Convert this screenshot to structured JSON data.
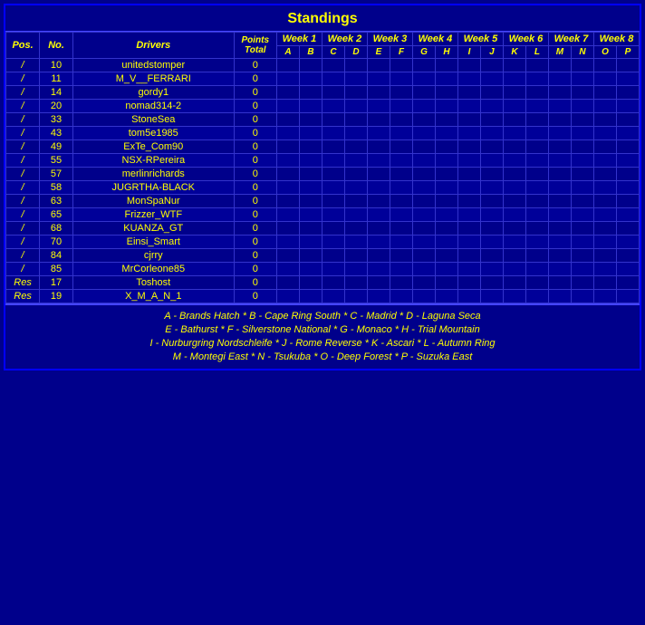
{
  "title": "Standings",
  "headers": {
    "pos": "Pos.",
    "no": "No.",
    "drivers": "Drivers",
    "points_total": "Points Total",
    "weeks": [
      "Week 1",
      "Week 2",
      "Week 3",
      "Week 4",
      "Week 5",
      "Week 6",
      "Week 7",
      "Week 8"
    ],
    "letters": [
      "A",
      "B",
      "C",
      "D",
      "E",
      "F",
      "G",
      "H",
      "I",
      "J",
      "K",
      "L",
      "M",
      "N",
      "O",
      "P"
    ]
  },
  "rows": [
    {
      "pos": "/",
      "no": "10",
      "driver": "unitedstomper",
      "pts": "0"
    },
    {
      "pos": "/",
      "no": "11",
      "driver": "M_V__FERRARI",
      "pts": "0"
    },
    {
      "pos": "/",
      "no": "14",
      "driver": "gordy1",
      "pts": "0"
    },
    {
      "pos": "/",
      "no": "20",
      "driver": "nomad314-2",
      "pts": "0"
    },
    {
      "pos": "/",
      "no": "33",
      "driver": "StoneSea",
      "pts": "0"
    },
    {
      "pos": "/",
      "no": "43",
      "driver": "tom5e1985",
      "pts": "0"
    },
    {
      "pos": "/",
      "no": "49",
      "driver": "ExTe_Com90",
      "pts": "0"
    },
    {
      "pos": "/",
      "no": "55",
      "driver": "NSX-RPereira",
      "pts": "0"
    },
    {
      "pos": "/",
      "no": "57",
      "driver": "merlinrichards",
      "pts": "0"
    },
    {
      "pos": "/",
      "no": "58",
      "driver": "JUGRTHA-BLACK",
      "pts": "0"
    },
    {
      "pos": "/",
      "no": "63",
      "driver": "MonSpaNur",
      "pts": "0"
    },
    {
      "pos": "/",
      "no": "65",
      "driver": "Frizzer_WTF",
      "pts": "0"
    },
    {
      "pos": "/",
      "no": "68",
      "driver": "KUANZA_GT",
      "pts": "0"
    },
    {
      "pos": "/",
      "no": "70",
      "driver": "Einsi_Smart",
      "pts": "0"
    },
    {
      "pos": "/",
      "no": "84",
      "driver": "cjrry",
      "pts": "0"
    },
    {
      "pos": "/",
      "no": "85",
      "driver": "MrCorleone85",
      "pts": "0"
    },
    {
      "pos": "Res",
      "no": "17",
      "driver": "Toshost",
      "pts": "0"
    },
    {
      "pos": "Res",
      "no": "19",
      "driver": "X_M_A_N_1",
      "pts": "0"
    }
  ],
  "footer": {
    "line1": "A - Brands Hatch   *   B - Cape Ring South   *   C - Madrid   *   D - Laguna Seca",
    "line2": "E - Bathurst   *   F - Silverstone National   *   G - Monaco   *   H - Trial Mountain",
    "line3": "I - Nurburgring Nordschleife   *   J - Rome Reverse   *   K - Ascari   *   L - Autumn Ring",
    "line4": "M - Montegi East   *   N - Tsukuba   *   O - Deep Forest   *   P - Suzuka East"
  }
}
